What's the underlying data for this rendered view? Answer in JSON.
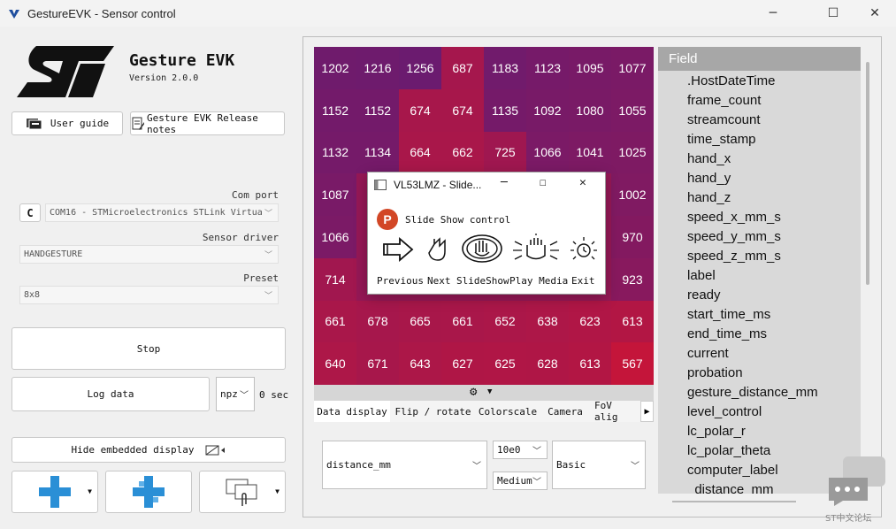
{
  "window": {
    "title": "GestureEVK - Sensor control",
    "minimize": "─",
    "maximize": "☐",
    "close": "✕"
  },
  "app": {
    "name": "Gesture EVK",
    "version": "Version 2.0.0"
  },
  "buttons": {
    "user_guide": "User guide",
    "release_notes": "Gesture EVK Release notes",
    "stop": "Stop",
    "log_data": "Log data",
    "hide_display": "Hide embedded display"
  },
  "port": {
    "label": "Com port",
    "value": "COM16 - STMicroelectronics STLink Virtua",
    "refresh": "C"
  },
  "driver": {
    "label": "Sensor driver",
    "value": "HANDGESTURE"
  },
  "preset": {
    "label": "Preset",
    "value": "8x8"
  },
  "log": {
    "format": "npz",
    "duration": "0 sec"
  },
  "heatmap": {
    "values": [
      [
        1202,
        1216,
        1256,
        687,
        1183,
        1123,
        1095,
        1077
      ],
      [
        1152,
        1152,
        674,
        674,
        1135,
        1092,
        1080,
        1055
      ],
      [
        1132,
        1134,
        664,
        662,
        725,
        1066,
        1041,
        1025
      ],
      [
        1087,
        null,
        null,
        null,
        null,
        null,
        null,
        1002
      ],
      [
        1066,
        null,
        null,
        null,
        null,
        null,
        null,
        970
      ],
      [
        714,
        null,
        null,
        null,
        null,
        null,
        null,
        923
      ],
      [
        661,
        678,
        665,
        661,
        652,
        638,
        623,
        613
      ],
      [
        640,
        671,
        643,
        627,
        625,
        628,
        613,
        567
      ]
    ],
    "colors": {
      "near": "#c4153a",
      "far": "#6b1b6f"
    }
  },
  "tabs": [
    "Data display",
    "Flip / rotate",
    "Colorscale",
    "Camera",
    "FoV alig"
  ],
  "display": {
    "field": "distance_mm",
    "scale": "10e0",
    "level": "Medium",
    "mode": "Basic"
  },
  "fields": {
    "header": "Field",
    "items": [
      ".HostDateTime",
      "frame_count",
      "streamcount",
      "time_stamp",
      "hand_x",
      "hand_y",
      "hand_z",
      "speed_x_mm_s",
      "speed_y_mm_s",
      "speed_z_mm_s",
      "label",
      "ready",
      "start_time_ms",
      "end_time_ms",
      "current",
      "probation",
      "gesture_distance_mm",
      "level_control",
      "lc_polar_r",
      "lc_polar_theta",
      "computer_label",
      "_distance_mm"
    ]
  },
  "popup": {
    "title": "VL53LMZ - Slide...",
    "heading": "Slide Show control",
    "ppt_letter": "P",
    "controls": [
      "Previous",
      "Next",
      "SlideShow",
      "Play Media",
      "Exit"
    ]
  },
  "watermark": "ST中文论坛"
}
